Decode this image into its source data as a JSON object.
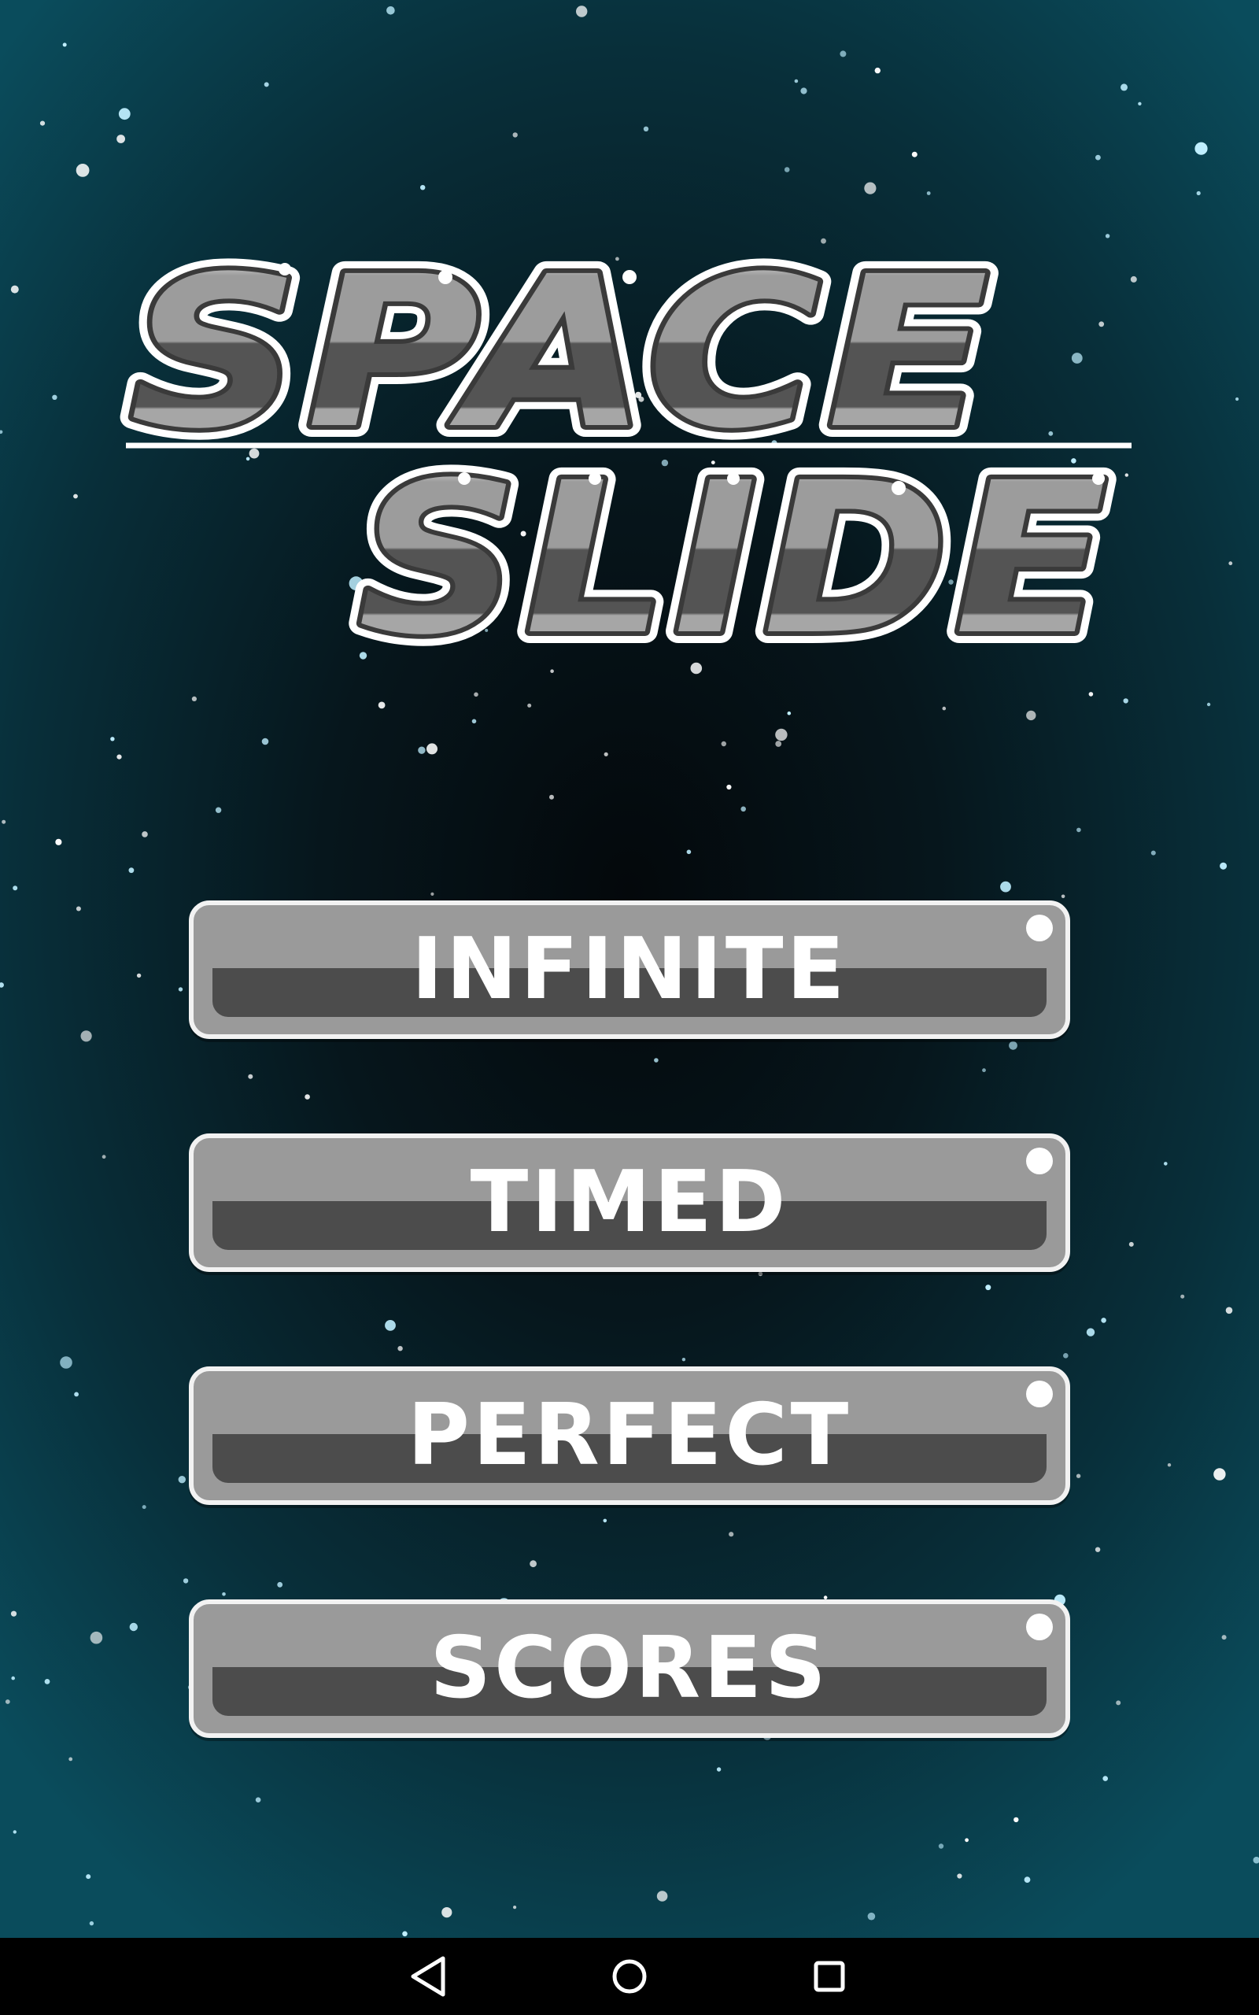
{
  "game": {
    "title_line1": "SPACE",
    "title_line2": "SLIDE"
  },
  "menu": {
    "buttons": [
      {
        "label": "INFINITE"
      },
      {
        "label": "TIMED"
      },
      {
        "label": "PERFECT"
      },
      {
        "label": "SCORES"
      }
    ]
  },
  "nav": {
    "back_icon": "triangle-back-icon",
    "home_icon": "circle-home-icon",
    "recents_icon": "square-recents-icon"
  },
  "colors": {
    "button_face": "#9a9a9a",
    "button_shadow_band": "#4c4c4c",
    "button_border": "#f2f2f2",
    "logo_light": "#a9a9a9",
    "logo_dark": "#4f4f4f",
    "star": "#ffffff"
  }
}
